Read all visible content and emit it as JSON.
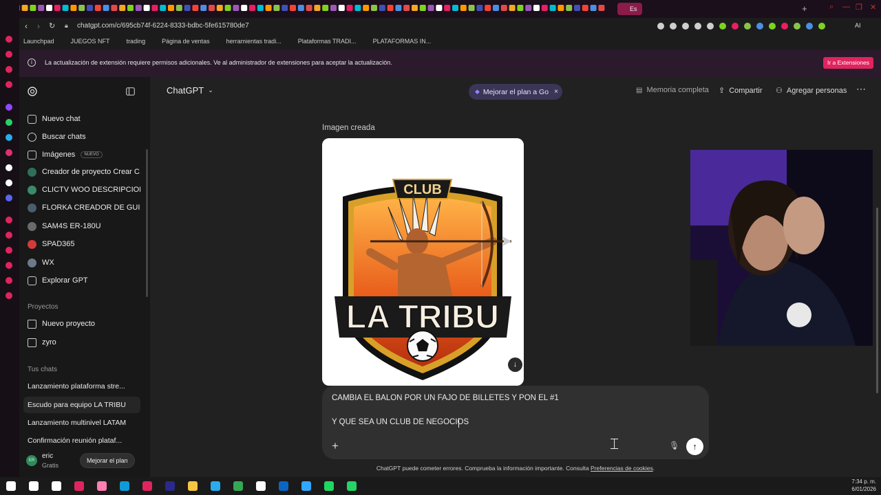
{
  "browser": {
    "url": "chatgpt.com/c/695cb74f-6224-8333-bdbc-5fe615780de7",
    "active_tab_label": "Es",
    "right_label": "AI"
  },
  "bookmarks": [
    "Launchpad",
    "JUEGOS NFT",
    "trading",
    "Página de ventas",
    "herramientas tradi...",
    "Plataformas TRADI...",
    "PLATAFORMAS IN..."
  ],
  "notice": {
    "text": "La actualización de extensión requiere permisos adicionales. Ve al administrador de extensiones para aceptar la actualización.",
    "button": "Ir a Extensiones"
  },
  "sidebar": {
    "nav": [
      {
        "label": "Nuevo chat",
        "icon": "edit-icon"
      },
      {
        "label": "Buscar chats",
        "icon": "search-icon"
      },
      {
        "label": "Imágenes",
        "icon": "image-icon",
        "badge": "NUEVO"
      },
      {
        "label": "Creador de proyecto Crear C...",
        "icon": "gpt-icon"
      },
      {
        "label": "CLICTV WOO DESCRIPCIONES",
        "icon": "gpt-icon"
      },
      {
        "label": "FLORKA CREADOR DE GUIO...",
        "icon": "gpt-icon"
      },
      {
        "label": "SAM4S ER-180U",
        "icon": "gpt-icon"
      },
      {
        "label": "SPAD365",
        "icon": "gpt-icon"
      },
      {
        "label": "WX",
        "icon": "gpt-icon"
      },
      {
        "label": "Explorar GPT",
        "icon": "cube-icon"
      }
    ],
    "projects_heading": "Proyectos",
    "projects": [
      {
        "label": "Nuevo proyecto",
        "icon": "folder-plus-icon"
      },
      {
        "label": "zyro",
        "icon": "folder-icon"
      }
    ],
    "chats_heading": "Tus chats",
    "chats": [
      "Lanzamiento plataforma stre...",
      "Escudo para equipo LA TRIBU",
      "Lanzamiento multinivel LATAM",
      "Confirmación reunión plataf..."
    ],
    "user": {
      "initials": "ER",
      "name": "eric",
      "plan": "Gratis",
      "upgrade_button": "Mejorar el plan"
    }
  },
  "topbar": {
    "model": "ChatGPT",
    "upgrade_pill": "Mejorar el plan a Go",
    "memory": "Memoria completa",
    "share": "Compartir",
    "add_people": "Agregar personas"
  },
  "conversation": {
    "image_heading": "Imagen creada",
    "image_crest": {
      "top_text": "CLUB",
      "main_text": "LA TRIBU"
    }
  },
  "composer": {
    "line1": "CAMBIA EL BALON POR UN FAJO DE BILLETES Y PON EL #1",
    "line2": "Y QUE SEA UN CLUB DE NEGOCIOS"
  },
  "footer": {
    "text": "ChatGPT puede cometer errores. Comprueba la información importante. Consulta",
    "link": "Preferencias de cookies",
    "end": "."
  },
  "taskbar": {
    "time": "7:34 p. m.",
    "date": "6/01/2026"
  },
  "colors": {
    "accent": "#e0245e",
    "pill": "#3b3556",
    "notice_bg": "#2a1a2c"
  }
}
